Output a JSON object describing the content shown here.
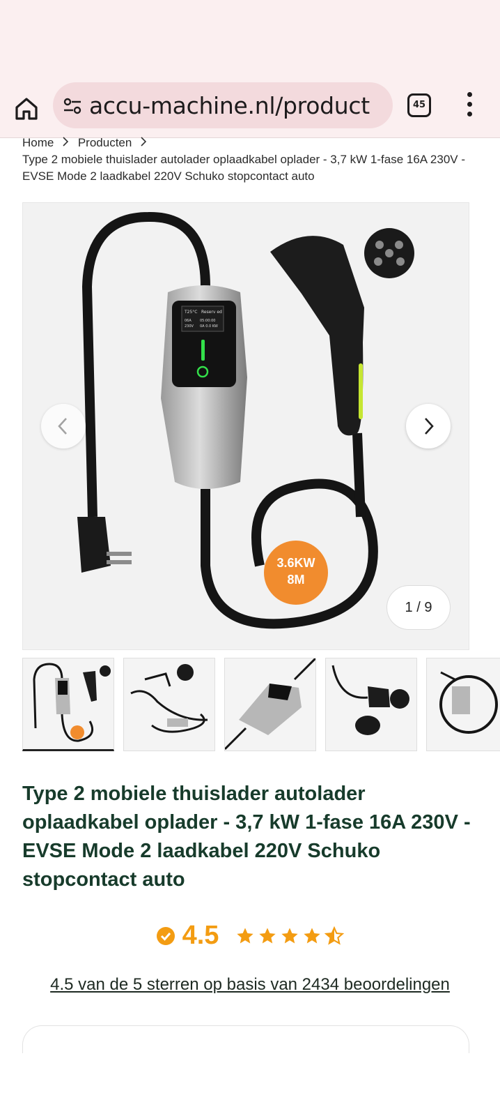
{
  "browser": {
    "url": "accu-machine.nl/product",
    "tab_count": "45"
  },
  "breadcrumb": {
    "items": [
      "Home",
      "Producten"
    ],
    "current": "Type 2 mobiele thuislader autolader oplaadkabel oplader - 3,7 kW 1-fase 16A 230V - EVSE Mode 2 laadkabel 220V Schuko stopcontact auto"
  },
  "gallery": {
    "counter": "1 / 9",
    "badge_power": "3.6KW",
    "badge_length": "8M",
    "screen_temp": "T25°C",
    "screen_reserv": "Reserv ed",
    "screen_amp": "06A",
    "screen_volt": "230V",
    "screen_time": "05:00:00",
    "screen_kw": "0A  0.0  KW"
  },
  "product": {
    "title": "Type 2 mobiele thuislader autolader oplaadkabel oplader - 3,7 kW 1-fase 16A 230V - EVSE Mode 2 laadkabel 220V Schuko stopcontact auto",
    "rating_value": "4.5",
    "rating_summary": "4.5 van de 5 sterren op basis van 2434 beoordelingen"
  },
  "colors": {
    "accent": "#f39c12",
    "title": "#173b2b",
    "chrome": "#fbeff0",
    "url_pill": "#f3dadd"
  },
  "icons": [
    "home-icon",
    "tune-icon",
    "tabs-icon",
    "more-vert-icon",
    "chevron-left-icon",
    "chevron-right-icon",
    "verified-check-icon",
    "star-icon",
    "half-star-icon"
  ]
}
